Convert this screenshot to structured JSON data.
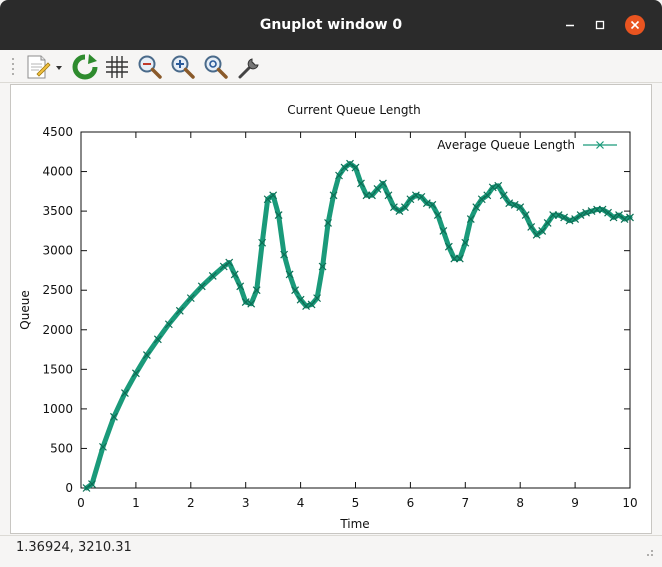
{
  "window": {
    "title": "Gnuplot window 0",
    "titlebar_color": "#2b2b2b",
    "close_color": "#e95420"
  },
  "toolbar": {
    "items": [
      {
        "name": "export-icon"
      },
      {
        "name": "replot-icon"
      },
      {
        "name": "grid-icon"
      },
      {
        "name": "zoom-out-icon"
      },
      {
        "name": "zoom-in-icon"
      },
      {
        "name": "zoom-fit-icon"
      },
      {
        "name": "settings-icon"
      }
    ]
  },
  "status": {
    "coords": "1.36924,  3210.31"
  },
  "chart_data": {
    "type": "line",
    "title": "Current Queue Length",
    "xlabel": "Time",
    "ylabel": "Queue",
    "xlim": [
      0,
      10
    ],
    "ylim": [
      0,
      4500
    ],
    "xticks": [
      "0",
      "1",
      "2",
      "3",
      "4",
      "5",
      "6",
      "7",
      "8",
      "9",
      "10"
    ],
    "yticks": [
      "0",
      "500",
      "1000",
      "1500",
      "2000",
      "2500",
      "3000",
      "3500",
      "4000",
      "4500"
    ],
    "grid": false,
    "legend_position": "top-right",
    "series": [
      {
        "name": "Average Queue Length",
        "color": "#1a9a7a",
        "marker": "x",
        "x": [
          0.1,
          0.2,
          0.4,
          0.6,
          0.8,
          1.0,
          1.2,
          1.4,
          1.6,
          1.8,
          2.0,
          2.2,
          2.4,
          2.6,
          2.7,
          2.8,
          2.9,
          3.0,
          3.1,
          3.2,
          3.3,
          3.4,
          3.5,
          3.6,
          3.7,
          3.8,
          3.9,
          4.0,
          4.1,
          4.2,
          4.3,
          4.4,
          4.5,
          4.6,
          4.7,
          4.8,
          4.9,
          5.0,
          5.1,
          5.2,
          5.3,
          5.4,
          5.5,
          5.6,
          5.7,
          5.8,
          5.9,
          6.0,
          6.1,
          6.2,
          6.3,
          6.4,
          6.5,
          6.6,
          6.7,
          6.8,
          6.9,
          7.0,
          7.1,
          7.2,
          7.3,
          7.4,
          7.5,
          7.6,
          7.7,
          7.8,
          7.9,
          8.0,
          8.1,
          8.2,
          8.3,
          8.4,
          8.5,
          8.6,
          8.7,
          8.8,
          8.9,
          9.0,
          9.1,
          9.2,
          9.3,
          9.4,
          9.5,
          9.6,
          9.7,
          9.8,
          9.9,
          10.0
        ],
        "y": [
          0,
          50,
          520,
          900,
          1200,
          1450,
          1680,
          1880,
          2070,
          2240,
          2400,
          2550,
          2680,
          2800,
          2850,
          2700,
          2550,
          2350,
          2330,
          2500,
          3100,
          3650,
          3700,
          3450,
          2950,
          2700,
          2500,
          2380,
          2300,
          2320,
          2400,
          2800,
          3350,
          3700,
          3950,
          4050,
          4100,
          4050,
          3850,
          3700,
          3700,
          3780,
          3850,
          3700,
          3550,
          3500,
          3550,
          3650,
          3700,
          3680,
          3600,
          3580,
          3450,
          3250,
          3050,
          2900,
          2900,
          3100,
          3400,
          3550,
          3650,
          3700,
          3800,
          3820,
          3700,
          3600,
          3580,
          3550,
          3450,
          3300,
          3200,
          3250,
          3350,
          3450,
          3450,
          3420,
          3380,
          3400,
          3450,
          3480,
          3500,
          3520,
          3520,
          3480,
          3420,
          3450,
          3400,
          3420
        ]
      }
    ]
  }
}
